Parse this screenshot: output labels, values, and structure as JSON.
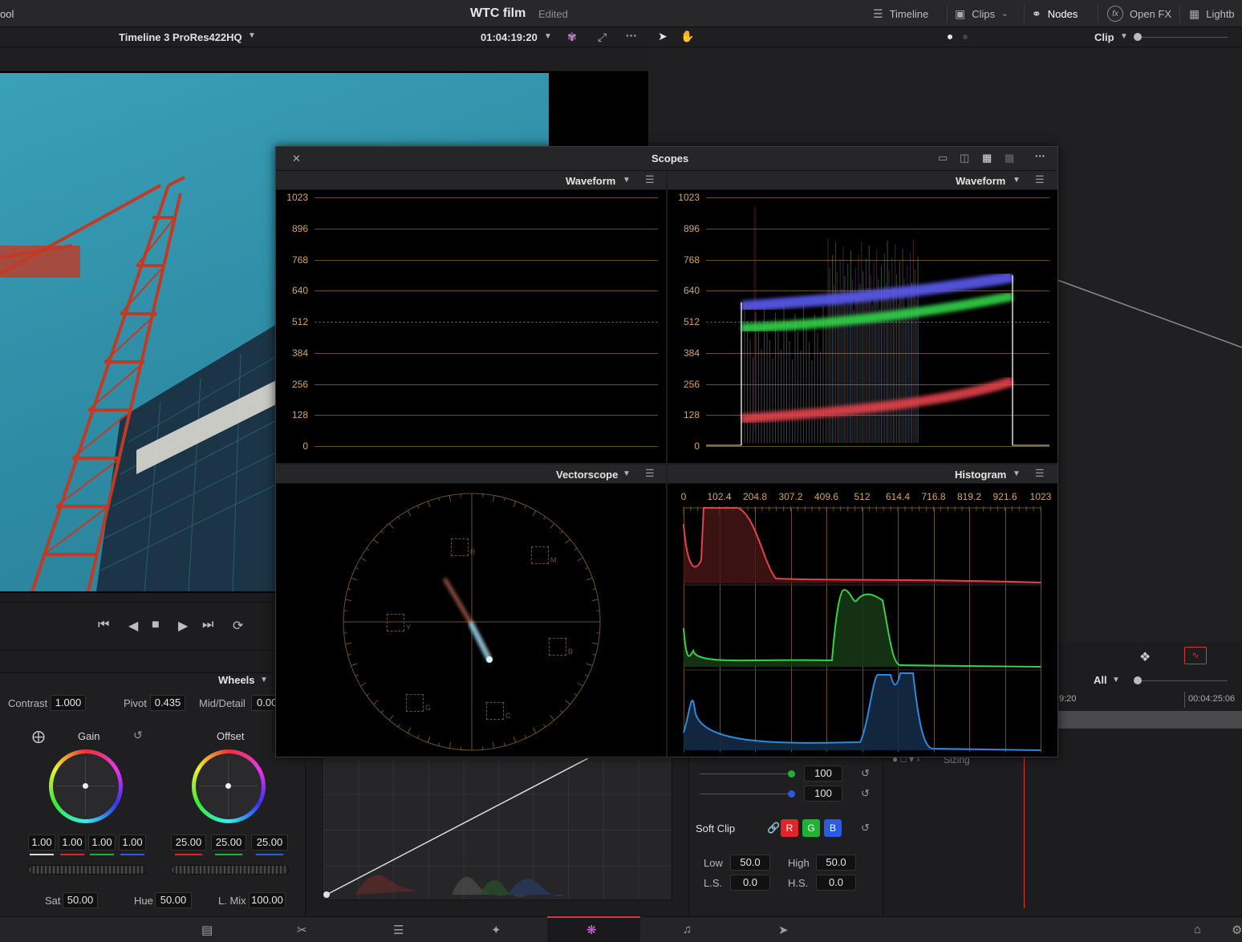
{
  "topbar": {
    "app_left": "ool",
    "project_title": "WTC film",
    "project_status": "Edited",
    "buttons": [
      {
        "label": "Timeline",
        "icon": "timeline-icon"
      },
      {
        "label": "Clips",
        "icon": "clips-icon"
      },
      {
        "label": "Nodes",
        "icon": "nodes-icon"
      },
      {
        "label": "Open FX",
        "icon": "fx-icon"
      },
      {
        "label": "Lightb",
        "icon": "lightbox-icon"
      }
    ]
  },
  "viewer": {
    "timeline_name": "Timeline 3 ProRes422HQ",
    "timecode": "01:04:19:20"
  },
  "nodes": {
    "clip_label": "Clip"
  },
  "scopes": {
    "title": "Scopes",
    "panels": {
      "top_left": "Waveform",
      "top_right": "Waveform",
      "bottom_left": "Vectorscope",
      "bottom_right": "Histogram"
    },
    "waveform_scale": [
      "1023",
      "896",
      "768",
      "640",
      "512",
      "384",
      "256",
      "128",
      "0"
    ],
    "histogram_scale": [
      "0",
      "102.4",
      "204.8",
      "307.2",
      "409.6",
      "512",
      "614.4",
      "716.8",
      "819.2",
      "921.6",
      "1023"
    ],
    "vector_targets": [
      "R",
      "M",
      "Y",
      "B",
      "G",
      "C"
    ]
  },
  "primaries": {
    "mode": "Wheels",
    "contrast_label": "Contrast",
    "contrast": "1.000",
    "pivot_label": "Pivot",
    "pivot": "0.435",
    "middetail_label": "Mid/Detail",
    "middetail": "0.00",
    "gain_label": "Gain",
    "offset_label": "Offset",
    "gain_values": [
      "1.00",
      "1.00",
      "1.00",
      "1.00"
    ],
    "offset_values": [
      "25.00",
      "25.00",
      "25.00"
    ],
    "sat_label": "Sat",
    "sat": "50.00",
    "hue_label": "Hue",
    "hue": "50.00",
    "lmix_label": "L. Mix",
    "lmix": "100.00"
  },
  "softclip": {
    "green_value": "100",
    "blue_value": "100",
    "label": "Soft Clip",
    "channels": [
      "R",
      "G",
      "B"
    ],
    "low_label": "Low",
    "low": "50.0",
    "high_label": "High",
    "high": "50.0",
    "ls_label": "L.S.",
    "ls": "0.0",
    "hs_label": "H.S.",
    "hs": "0.0"
  },
  "keyframes": {
    "filter": "All",
    "time_a": "9:20",
    "time_b": "00:04:25:06",
    "track_label": "Sizing"
  },
  "colors": {
    "accent_orange": "#d6a55e",
    "red": "#e0242a",
    "green": "#20b232",
    "blue": "#2a5be0"
  }
}
